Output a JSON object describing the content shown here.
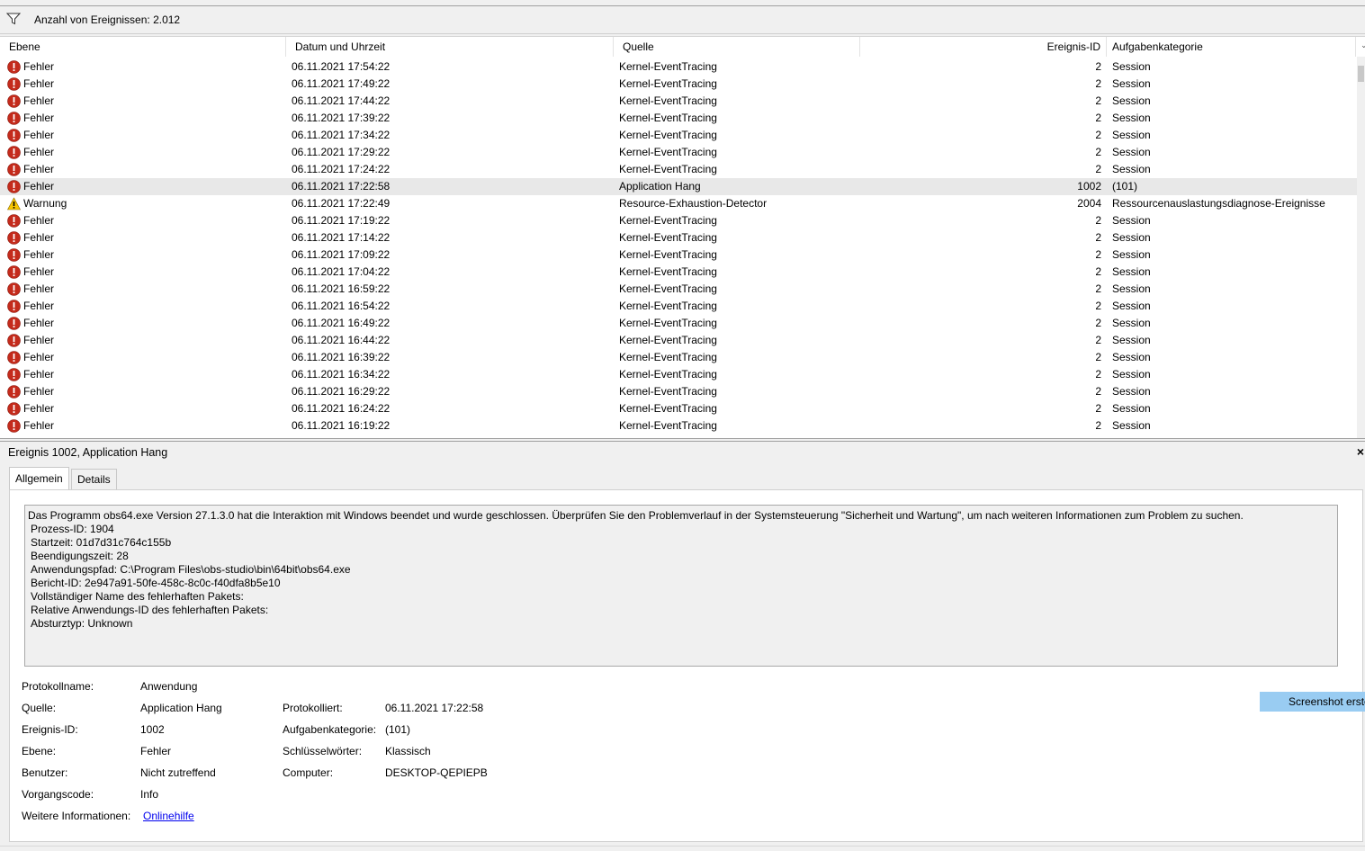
{
  "filter": {
    "count_label": "Anzahl von Ereignissen: 2.012"
  },
  "columns": {
    "level": "Ebene",
    "date": "Datum und Uhrzeit",
    "source": "Quelle",
    "id": "Ereignis-ID",
    "category": "Aufgabenkategorie"
  },
  "colors": {
    "error": "#c42b1c",
    "warning": "#f7c600",
    "selected": "#e8e8e8",
    "link": "#0000ee",
    "button": "#99ccf2"
  },
  "rows": [
    {
      "level": "Fehler",
      "icon": "error-icon",
      "date": "06.11.2021 17:54:22",
      "source": "Kernel-EventTracing",
      "id": "2",
      "category": "Session"
    },
    {
      "level": "Fehler",
      "icon": "error-icon",
      "date": "06.11.2021 17:49:22",
      "source": "Kernel-EventTracing",
      "id": "2",
      "category": "Session"
    },
    {
      "level": "Fehler",
      "icon": "error-icon",
      "date": "06.11.2021 17:44:22",
      "source": "Kernel-EventTracing",
      "id": "2",
      "category": "Session"
    },
    {
      "level": "Fehler",
      "icon": "error-icon",
      "date": "06.11.2021 17:39:22",
      "source": "Kernel-EventTracing",
      "id": "2",
      "category": "Session"
    },
    {
      "level": "Fehler",
      "icon": "error-icon",
      "date": "06.11.2021 17:34:22",
      "source": "Kernel-EventTracing",
      "id": "2",
      "category": "Session"
    },
    {
      "level": "Fehler",
      "icon": "error-icon",
      "date": "06.11.2021 17:29:22",
      "source": "Kernel-EventTracing",
      "id": "2",
      "category": "Session"
    },
    {
      "level": "Fehler",
      "icon": "error-icon",
      "date": "06.11.2021 17:24:22",
      "source": "Kernel-EventTracing",
      "id": "2",
      "category": "Session"
    },
    {
      "level": "Fehler",
      "icon": "error-icon",
      "date": "06.11.2021 17:22:58",
      "source": "Application Hang",
      "id": "1002",
      "category": "(101)",
      "selected": true
    },
    {
      "level": "Warnung",
      "icon": "warning-icon",
      "date": "06.11.2021 17:22:49",
      "source": "Resource-Exhaustion-Detector",
      "id": "2004",
      "category": "Ressourcenauslastungsdiagnose-Ereignisse"
    },
    {
      "level": "Fehler",
      "icon": "error-icon",
      "date": "06.11.2021 17:19:22",
      "source": "Kernel-EventTracing",
      "id": "2",
      "category": "Session"
    },
    {
      "level": "Fehler",
      "icon": "error-icon",
      "date": "06.11.2021 17:14:22",
      "source": "Kernel-EventTracing",
      "id": "2",
      "category": "Session"
    },
    {
      "level": "Fehler",
      "icon": "error-icon",
      "date": "06.11.2021 17:09:22",
      "source": "Kernel-EventTracing",
      "id": "2",
      "category": "Session"
    },
    {
      "level": "Fehler",
      "icon": "error-icon",
      "date": "06.11.2021 17:04:22",
      "source": "Kernel-EventTracing",
      "id": "2",
      "category": "Session"
    },
    {
      "level": "Fehler",
      "icon": "error-icon",
      "date": "06.11.2021 16:59:22",
      "source": "Kernel-EventTracing",
      "id": "2",
      "category": "Session"
    },
    {
      "level": "Fehler",
      "icon": "error-icon",
      "date": "06.11.2021 16:54:22",
      "source": "Kernel-EventTracing",
      "id": "2",
      "category": "Session"
    },
    {
      "level": "Fehler",
      "icon": "error-icon",
      "date": "06.11.2021 16:49:22",
      "source": "Kernel-EventTracing",
      "id": "2",
      "category": "Session"
    },
    {
      "level": "Fehler",
      "icon": "error-icon",
      "date": "06.11.2021 16:44:22",
      "source": "Kernel-EventTracing",
      "id": "2",
      "category": "Session"
    },
    {
      "level": "Fehler",
      "icon": "error-icon",
      "date": "06.11.2021 16:39:22",
      "source": "Kernel-EventTracing",
      "id": "2",
      "category": "Session"
    },
    {
      "level": "Fehler",
      "icon": "error-icon",
      "date": "06.11.2021 16:34:22",
      "source": "Kernel-EventTracing",
      "id": "2",
      "category": "Session"
    },
    {
      "level": "Fehler",
      "icon": "error-icon",
      "date": "06.11.2021 16:29:22",
      "source": "Kernel-EventTracing",
      "id": "2",
      "category": "Session"
    },
    {
      "level": "Fehler",
      "icon": "error-icon",
      "date": "06.11.2021 16:24:22",
      "source": "Kernel-EventTracing",
      "id": "2",
      "category": "Session"
    },
    {
      "level": "Fehler",
      "icon": "error-icon",
      "date": "06.11.2021 16:19:22",
      "source": "Kernel-EventTracing",
      "id": "2",
      "category": "Session"
    }
  ],
  "detail": {
    "title": "Ereignis 1002, Application Hang",
    "close": "×",
    "tabs": {
      "general": "Allgemein",
      "details": "Details"
    },
    "message": {
      "line1": "Das Programm obs64.exe Version 27.1.3.0 hat die Interaktion mit Windows beendet und wurde geschlossen. Überprüfen Sie den Problemverlauf in der Systemsteuerung \"Sicherheit und Wartung\", um nach weiteren Informationen zum Problem zu suchen.",
      "line2": "Prozess-ID: 1904",
      "line3": "Startzeit: 01d7d31c764c155b",
      "line4": "Beendigungszeit: 28",
      "line5": "Anwendungspfad: C:\\Program Files\\obs-studio\\bin\\64bit\\obs64.exe",
      "line6": "Bericht-ID: 2e947a91-50fe-458c-8c0c-f40dfa8b5e10",
      "line7": "Vollständiger Name des fehlerhaften Pakets:",
      "line8": "Relative Anwendungs-ID des fehlerhaften Pakets:",
      "line9": "Absturztyp: Unknown"
    },
    "props": {
      "log_label": "Protokollname:",
      "log_value": "Anwendung",
      "source_label": "Quelle:",
      "source_value": "Application Hang",
      "logged_label": "Protokolliert:",
      "logged_value": "06.11.2021 17:22:58",
      "id_label": "Ereignis-ID:",
      "id_value": "1002",
      "category_label": "Aufgabenkategorie:",
      "category_value": "(101)",
      "level_label": "Ebene:",
      "level_value": "Fehler",
      "keywords_label": "Schlüsselwörter:",
      "keywords_value": "Klassisch",
      "user_label": "Benutzer:",
      "user_value": "Nicht zutreffend",
      "computer_label": "Computer:",
      "computer_value": "DESKTOP-QEPIEPB",
      "opcode_label": "Vorgangscode:",
      "opcode_value": "Info",
      "more_label": "Weitere Informationen:",
      "more_link": "Onlinehilfe"
    }
  },
  "screenshot_button": "Screenshot erste"
}
